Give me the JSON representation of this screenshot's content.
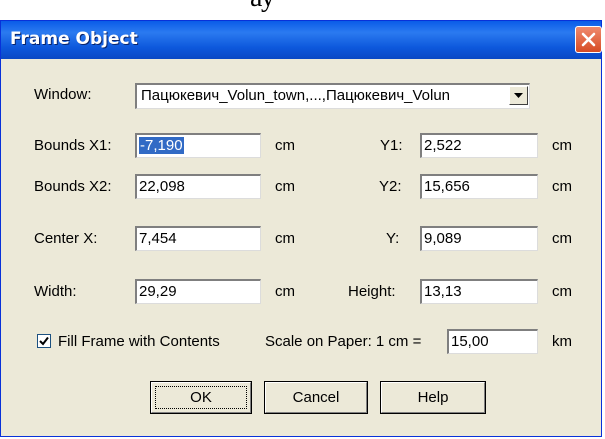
{
  "page_heading": "ау",
  "dialog": {
    "title": "Frame Object",
    "window_label": "Window:",
    "window_value": "Пацюкевич_Volun_town,...,Пацюкевич_Volun",
    "fields": {
      "bounds_x1": {
        "label": "Bounds X1:",
        "value": "-7,190",
        "unit": "cm"
      },
      "y1": {
        "label": "Y1:",
        "value": "2,522",
        "unit": "cm"
      },
      "bounds_x2": {
        "label": "Bounds X2:",
        "value": "22,098",
        "unit": "cm"
      },
      "y2": {
        "label": "Y2:",
        "value": "15,656",
        "unit": "cm"
      },
      "center_x": {
        "label": "Center X:",
        "value": "7,454",
        "unit": "cm"
      },
      "center_y": {
        "label": "Y:",
        "value": "9,089",
        "unit": "cm"
      },
      "width": {
        "label": "Width:",
        "value": "29,29",
        "unit": "cm"
      },
      "height": {
        "label": "Height:",
        "value": "13,13",
        "unit": "cm"
      }
    },
    "fill_frame": {
      "label": "Fill Frame with Contents",
      "checked": true
    },
    "scale": {
      "label": "Scale on Paper: 1 cm =",
      "value": "15,00",
      "unit": "km"
    },
    "buttons": {
      "ok": "OK",
      "cancel": "Cancel",
      "help": "Help"
    }
  }
}
